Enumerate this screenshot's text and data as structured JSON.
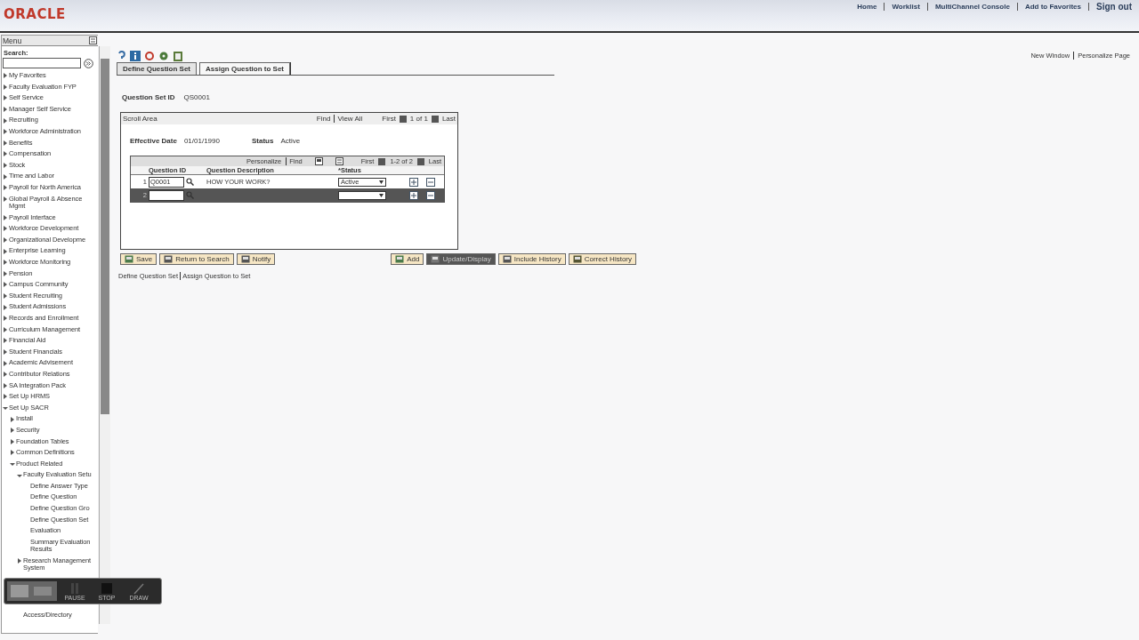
{
  "header": {
    "logo": "ORACLE",
    "links": [
      "Home",
      "Worklist",
      "MultiChannel Console",
      "Add to Favorites"
    ],
    "signout": "Sign out"
  },
  "menu": {
    "title": "Menu",
    "search_label": "Search:",
    "items": [
      {
        "label": "My Favorites",
        "kind": "folder",
        "expanded": false
      },
      {
        "label": "Faculty Evaluation FYP",
        "kind": "folder",
        "expanded": false
      },
      {
        "label": "Self Service",
        "kind": "folder",
        "expanded": false
      },
      {
        "label": "Manager Self Service",
        "kind": "folder",
        "expanded": false
      },
      {
        "label": "Recruiting",
        "kind": "folder",
        "expanded": false
      },
      {
        "label": "Workforce Administration",
        "kind": "folder",
        "expanded": false
      },
      {
        "label": "Benefits",
        "kind": "folder",
        "expanded": false
      },
      {
        "label": "Compensation",
        "kind": "folder",
        "expanded": false
      },
      {
        "label": "Stock",
        "kind": "folder",
        "expanded": false
      },
      {
        "label": "Time and Labor",
        "kind": "folder",
        "expanded": false
      },
      {
        "label": "Payroll for North America",
        "kind": "folder",
        "expanded": false
      },
      {
        "label": "Global Payroll & Absence Mgmt",
        "kind": "folder",
        "expanded": false
      },
      {
        "label": "Payroll Interface",
        "kind": "folder",
        "expanded": false
      },
      {
        "label": "Workforce Development",
        "kind": "folder",
        "expanded": false
      },
      {
        "label": "Organizational Developme",
        "kind": "folder",
        "expanded": false
      },
      {
        "label": "Enterprise Learning",
        "kind": "folder",
        "expanded": false
      },
      {
        "label": "Workforce Monitoring",
        "kind": "folder",
        "expanded": false
      },
      {
        "label": "Pension",
        "kind": "folder",
        "expanded": false
      },
      {
        "label": "Campus Community",
        "kind": "folder",
        "expanded": false
      },
      {
        "label": "Student Recruiting",
        "kind": "folder",
        "expanded": false
      },
      {
        "label": "Student Admissions",
        "kind": "folder",
        "expanded": false
      },
      {
        "label": "Records and Enrollment",
        "kind": "folder",
        "expanded": false
      },
      {
        "label": "Curriculum Management",
        "kind": "folder",
        "expanded": false
      },
      {
        "label": "Financial Aid",
        "kind": "folder",
        "expanded": false
      },
      {
        "label": "Student Financials",
        "kind": "folder",
        "expanded": false
      },
      {
        "label": "Academic Advisement",
        "kind": "folder",
        "expanded": false
      },
      {
        "label": "Contributor Relations",
        "kind": "folder",
        "expanded": false
      },
      {
        "label": "SA Integration Pack",
        "kind": "folder",
        "expanded": false
      },
      {
        "label": "Set Up HRMS",
        "kind": "folder",
        "expanded": false
      },
      {
        "label": "Set Up SACR",
        "kind": "folder",
        "expanded": true,
        "children": [
          {
            "label": "Install",
            "kind": "folder",
            "expanded": false
          },
          {
            "label": "Security",
            "kind": "folder",
            "expanded": false
          },
          {
            "label": "Foundation Tables",
            "kind": "folder",
            "expanded": false
          },
          {
            "label": "Common Definitions",
            "kind": "folder",
            "expanded": false
          },
          {
            "label": "Product Related",
            "kind": "folder",
            "expanded": true,
            "children": [
              {
                "label": "Faculty Evaluation Setu",
                "kind": "folder",
                "expanded": true,
                "children": [
                  {
                    "label": "Define Answer Type",
                    "kind": "leaf"
                  },
                  {
                    "label": "Define Question",
                    "kind": "leaf"
                  },
                  {
                    "label": "Define Question Gro",
                    "kind": "leaf"
                  },
                  {
                    "label": "Define Question Set",
                    "kind": "leaf"
                  },
                  {
                    "label": "Evaluation",
                    "kind": "leaf"
                  },
                  {
                    "label": "Summary Evaluation Results",
                    "kind": "leaf"
                  }
                ]
              },
              {
                "label": "Research Management System",
                "kind": "folder",
                "expanded": false
              },
              {
                "label": "Access/Directory",
                "kind": "leaf"
              }
            ]
          }
        ]
      }
    ]
  },
  "recorder": {
    "buttons": [
      "PAUSE",
      "STOP",
      "DRAW"
    ]
  },
  "page_links": [
    "New Window",
    "Personalize Page"
  ],
  "tabs": [
    {
      "label": "Define Question Set",
      "selected": false
    },
    {
      "label": "Assign Question to Set",
      "selected": true
    }
  ],
  "question_set": {
    "label": "Question Set ID",
    "value": "QS0001"
  },
  "scroll_area": {
    "title": "Scroll Area",
    "find": "Find",
    "view_all": "View All",
    "first": "First",
    "count": "1 of 1",
    "last": "Last",
    "effective_date_label": "Effective Date",
    "effective_date": "01/01/1990",
    "status_label": "Status",
    "status": "Active"
  },
  "grid": {
    "personalize": "Personalize",
    "find": "Find",
    "first": "First",
    "count": "1-2 of 2",
    "last": "Last",
    "columns": [
      "Question ID",
      "Question Description",
      "*Status"
    ],
    "rows": [
      {
        "number": "1",
        "question_id": "Q0001",
        "description": "HOW YOUR WORK?",
        "status": "Active",
        "selected": false
      },
      {
        "number": "2",
        "question_id": "",
        "description": "",
        "status": "",
        "selected": true
      }
    ]
  },
  "buttons_left": [
    {
      "label": "Save",
      "selected": false
    },
    {
      "label": "Return to Search",
      "selected": false
    },
    {
      "label": "Notify",
      "selected": false
    }
  ],
  "buttons_right": [
    {
      "label": "Add",
      "selected": false
    },
    {
      "label": "Update/Display",
      "selected": true
    },
    {
      "label": "Include History",
      "selected": false
    },
    {
      "label": "Correct History",
      "selected": false
    }
  ],
  "footer_links": [
    "Define Question Set",
    "Assign Question to Set"
  ]
}
